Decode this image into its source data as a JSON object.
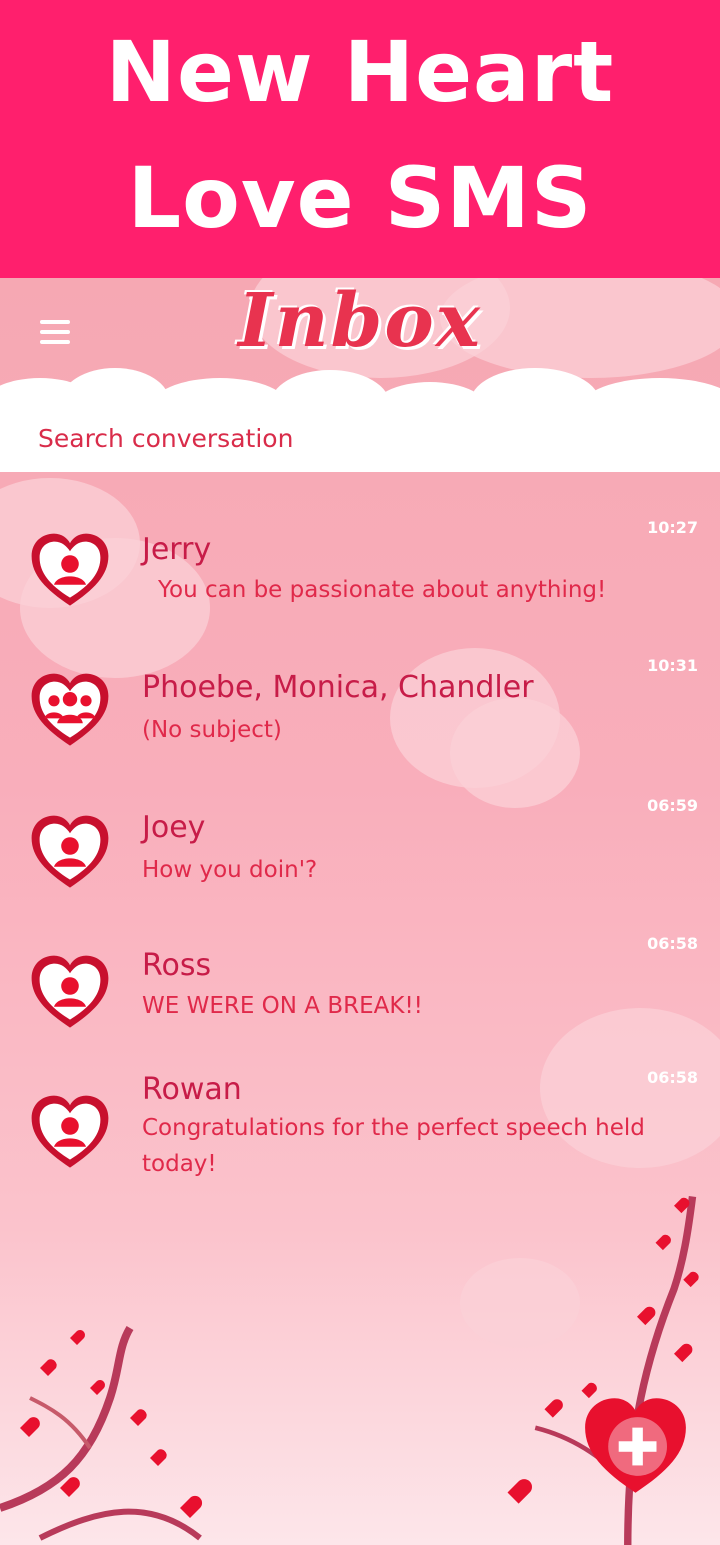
{
  "banner": {
    "line1": "New Heart",
    "line2": "Love SMS"
  },
  "header": {
    "title": "Inbox"
  },
  "search": {
    "placeholder": "Search conversation"
  },
  "conversations": [
    {
      "name": "Jerry",
      "message": "You can be passionate about anything!",
      "time": "10:27",
      "avatar": "person-heart-icon"
    },
    {
      "name": "Phoebe, Monica, Chandler",
      "message": "(No subject)",
      "time": "10:31",
      "avatar": "group-heart-icon"
    },
    {
      "name": "Joey",
      "message": "How you doin'?",
      "time": "06:59",
      "avatar": "person-heart-icon"
    },
    {
      "name": "Ross",
      "message": "WE WERE ON A BREAK!!",
      "time": "06:58",
      "avatar": "person-heart-icon"
    },
    {
      "name": "Rowan",
      "message": "Congratulations for the perfect speech held today!",
      "time": "06:58",
      "avatar": "person-heart-icon"
    }
  ],
  "colors": {
    "banner": "#ff1f6d",
    "accent": "#e0294a",
    "name": "#c71c48"
  },
  "icons": {
    "menu": "hamburger-menu-icon",
    "fab": "heart-plus-icon"
  }
}
